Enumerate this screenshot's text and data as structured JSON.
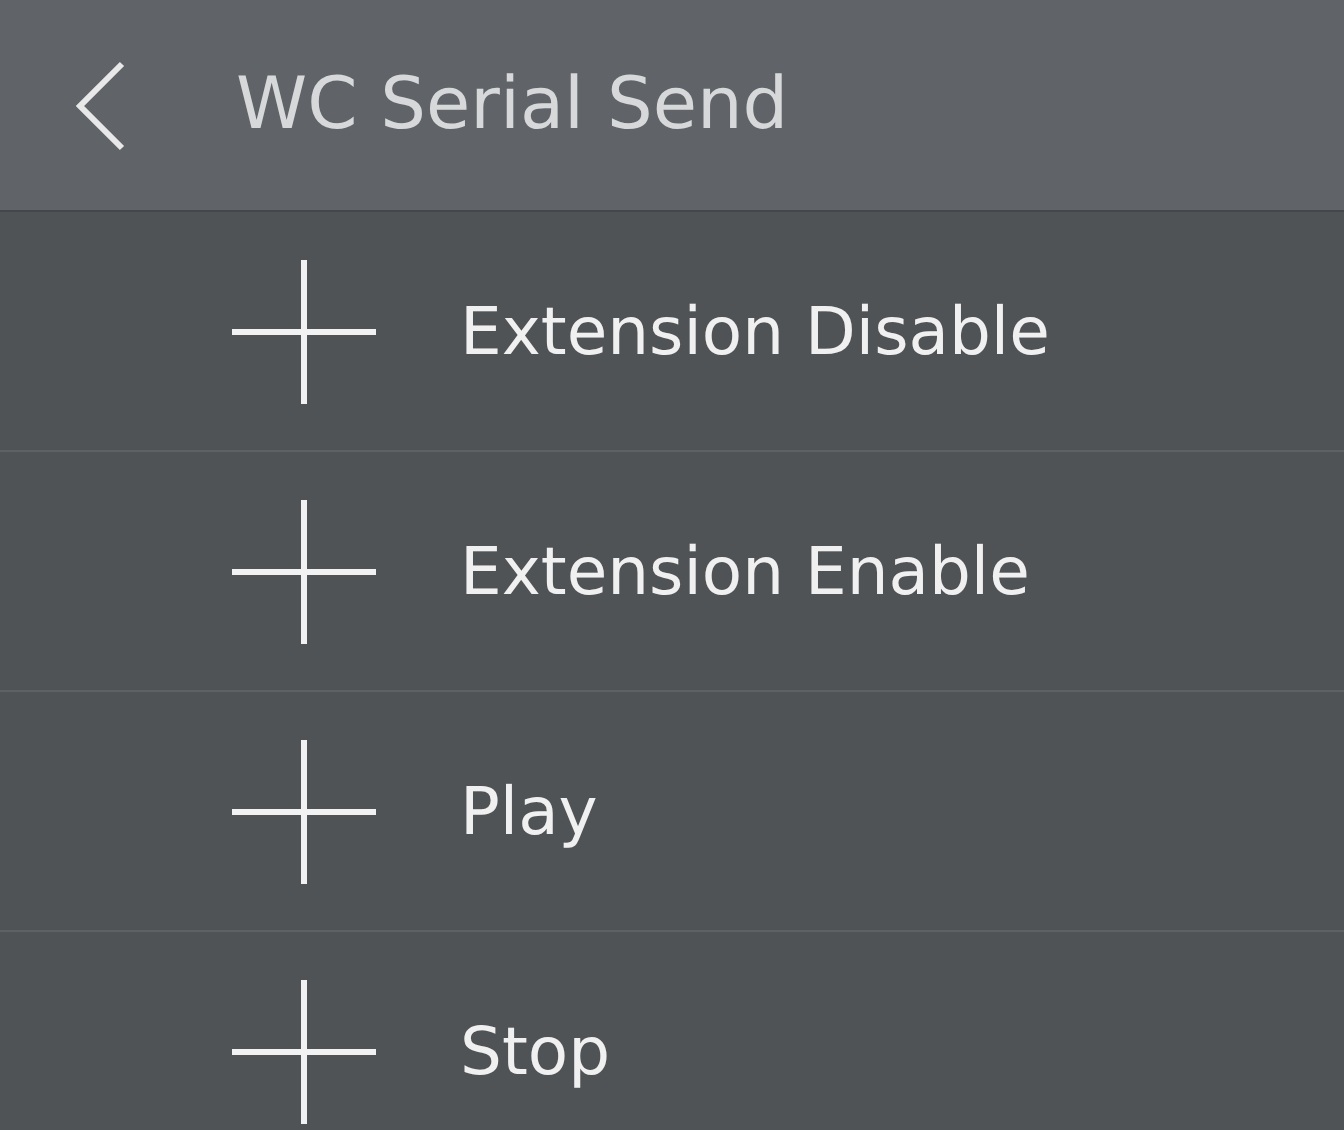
{
  "header": {
    "title": "WC Serial Send"
  },
  "items": [
    {
      "label": "Extension Disable"
    },
    {
      "label": "Extension Enable"
    },
    {
      "label": "Play"
    },
    {
      "label": "Stop"
    }
  ]
}
